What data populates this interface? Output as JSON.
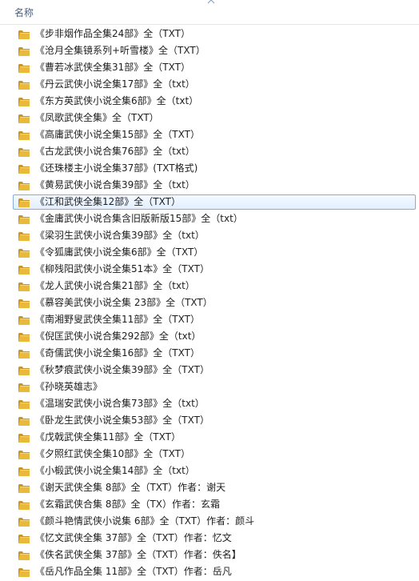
{
  "header": {
    "column_name": "名称"
  },
  "colors": {
    "folder": "#e8b93a",
    "folder_dark": "#c7952a",
    "selection_border": "#84acdd"
  },
  "selected_index": 10,
  "items": [
    {
      "name": "《步非烟作品全集24部》全（TXT）"
    },
    {
      "name": "《沧月全集镜系列+听雪楼》全（TXT）"
    },
    {
      "name": "《曹若冰武侠全集31部》全（TXT）"
    },
    {
      "name": "《丹云武侠小说全集17部》全（txt）"
    },
    {
      "name": "《东方英武侠小说全集6部》全（txt）"
    },
    {
      "name": "《凤歌武侠全集》全（TXT）"
    },
    {
      "name": "《高庸武侠小说全集15部》全（TXT）"
    },
    {
      "name": "《古龙武侠小说合集76部》全（txt）"
    },
    {
      "name": "《还珠楼主小说全集37部》(TXT格式)"
    },
    {
      "name": "《黄易武侠小说合集39部》全（txt）"
    },
    {
      "name": "《江和武侠全集12部》全（TXT）"
    },
    {
      "name": "《金庸武侠小说合集含旧版新版15部》全（txt）"
    },
    {
      "name": "《梁羽生武侠小说合集39部》全（txt）"
    },
    {
      "name": "《令狐庸武侠小说全集6部》全（TXT）"
    },
    {
      "name": "《柳残阳武侠小说全集51本》全（TXT）"
    },
    {
      "name": "《龙人武侠小说合集21部》全（txt）"
    },
    {
      "name": "《慕容美武侠小说全集 23部》全（TXT）"
    },
    {
      "name": "《南湘野叟武侠全集11部》全（TXT）"
    },
    {
      "name": "《倪匡武侠小说合集292部》全（txt）"
    },
    {
      "name": "《奇儒武侠小说全集16部》全（TXT）"
    },
    {
      "name": "《秋梦痕武侠小说全集39部》全（TXT）"
    },
    {
      "name": "《孙晓英雄志》"
    },
    {
      "name": "《温瑞安武侠小说合集73部》全（txt）"
    },
    {
      "name": "《卧龙生武侠小说全集53部》全（TXT）"
    },
    {
      "name": "《戊戟武侠全集11部》全（TXT）"
    },
    {
      "name": "《夕照红武侠全集10部》全（TXT）"
    },
    {
      "name": "《小椴武侠小说全集14部》全（txt）"
    },
    {
      "name": "《谢天武侠全集 8部》全（TXT）作者：谢天"
    },
    {
      "name": "《玄霜武侠合集 8部》全（TX）作者：玄霜"
    },
    {
      "name": "《颜斗艳情武侠小说集 6部》全（TXT）作者：颜斗"
    },
    {
      "name": "《忆文武侠全集 37部》全（TXT）作者：忆文"
    },
    {
      "name": "《佚名武侠全集 37部》全（TXT）作者：佚名】"
    },
    {
      "name": "《岳凡作品全集 11部》全（TXT）作者：岳凡"
    }
  ]
}
